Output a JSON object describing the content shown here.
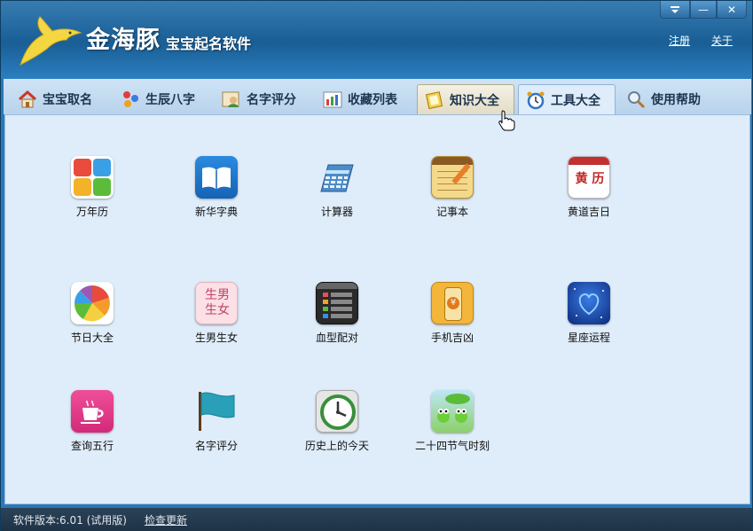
{
  "app": {
    "title": "金海豚",
    "subtitle": "宝宝起名软件"
  },
  "window_controls": {
    "menu_icon": "menu-dropdown-icon",
    "minimize_glyph": "—",
    "close_glyph": "✕"
  },
  "top_links": {
    "register": "注册",
    "about": "关于"
  },
  "tabs": [
    {
      "label": "宝宝取名",
      "icon": "house-icon"
    },
    {
      "label": "生辰八字",
      "icon": "molecule-icon"
    },
    {
      "label": "名字评分",
      "icon": "person-icon"
    },
    {
      "label": "收藏列表",
      "icon": "chart-icon"
    },
    {
      "label": "知识大全",
      "icon": "book-icon"
    },
    {
      "label": "工具大全",
      "icon": "alarm-clock-icon"
    },
    {
      "label": "使用帮助",
      "icon": "magnifier-icon"
    }
  ],
  "tools": [
    {
      "label": "万年历",
      "icon": "calendar-tiles-icon"
    },
    {
      "label": "新华字典",
      "icon": "open-book-icon"
    },
    {
      "label": "计算器",
      "icon": "calculator-icon"
    },
    {
      "label": "记事本",
      "icon": "notepad-icon"
    },
    {
      "label": "黄道吉日",
      "icon": "almanac-icon",
      "icon_text": "黄 历"
    },
    {
      "label": "节日大全",
      "icon": "color-wheel-icon"
    },
    {
      "label": "生男生女",
      "icon": "gender-icon",
      "icon_text": "生男生女"
    },
    {
      "label": "血型配对",
      "icon": "bars-icon"
    },
    {
      "label": "手机吉凶",
      "icon": "phone-icon",
      "icon_text": "¥"
    },
    {
      "label": "星座运程",
      "icon": "stars-heart-icon"
    },
    {
      "label": "查询五行",
      "icon": "cup-icon"
    },
    {
      "label": "名字评分",
      "icon": "flag-icon"
    },
    {
      "label": "历史上的今天",
      "icon": "clock-icon"
    },
    {
      "label": "二十四节气时刻",
      "icon": "frogs-icon"
    }
  ],
  "status": {
    "version": "软件版本:6.01 (试用版)",
    "check_update": "检查更新"
  },
  "colors": {
    "header": "#1a5f96",
    "tabbar": "#c3dbf1",
    "content": "#dfecf9",
    "statusbar": "#243a4f"
  }
}
